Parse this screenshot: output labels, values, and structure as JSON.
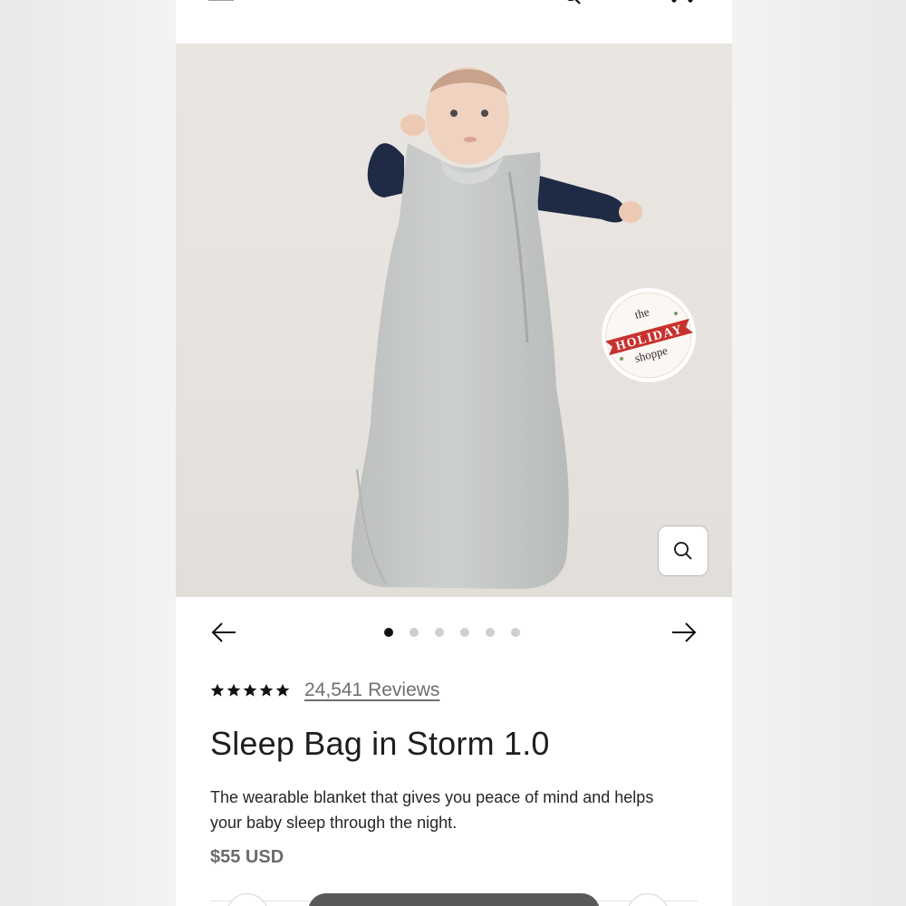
{
  "header": {
    "menu_icon": "hamburger-menu-icon",
    "search_icon": "search-icon",
    "account_icon": "account-icon",
    "cart_icon": "cart-icon"
  },
  "gallery": {
    "badge": {
      "line1": "the",
      "line2": "HOLIDAY",
      "line3": "shoppe"
    },
    "zoom_icon": "magnifier-icon",
    "slide_count": 6,
    "active_slide": 1
  },
  "product": {
    "rating_stars": 5,
    "reviews_label": "24,541 Reviews",
    "title": "Sleep Bag in Storm 1.0",
    "description": "The wearable blanket that gives you peace of mind and helps your baby sleep through the night.",
    "price": "$55 USD"
  },
  "colors": {
    "badge_red": "#c8322e",
    "sleep_bag": "#c9cccb",
    "sleeves": "#1f2a44"
  }
}
